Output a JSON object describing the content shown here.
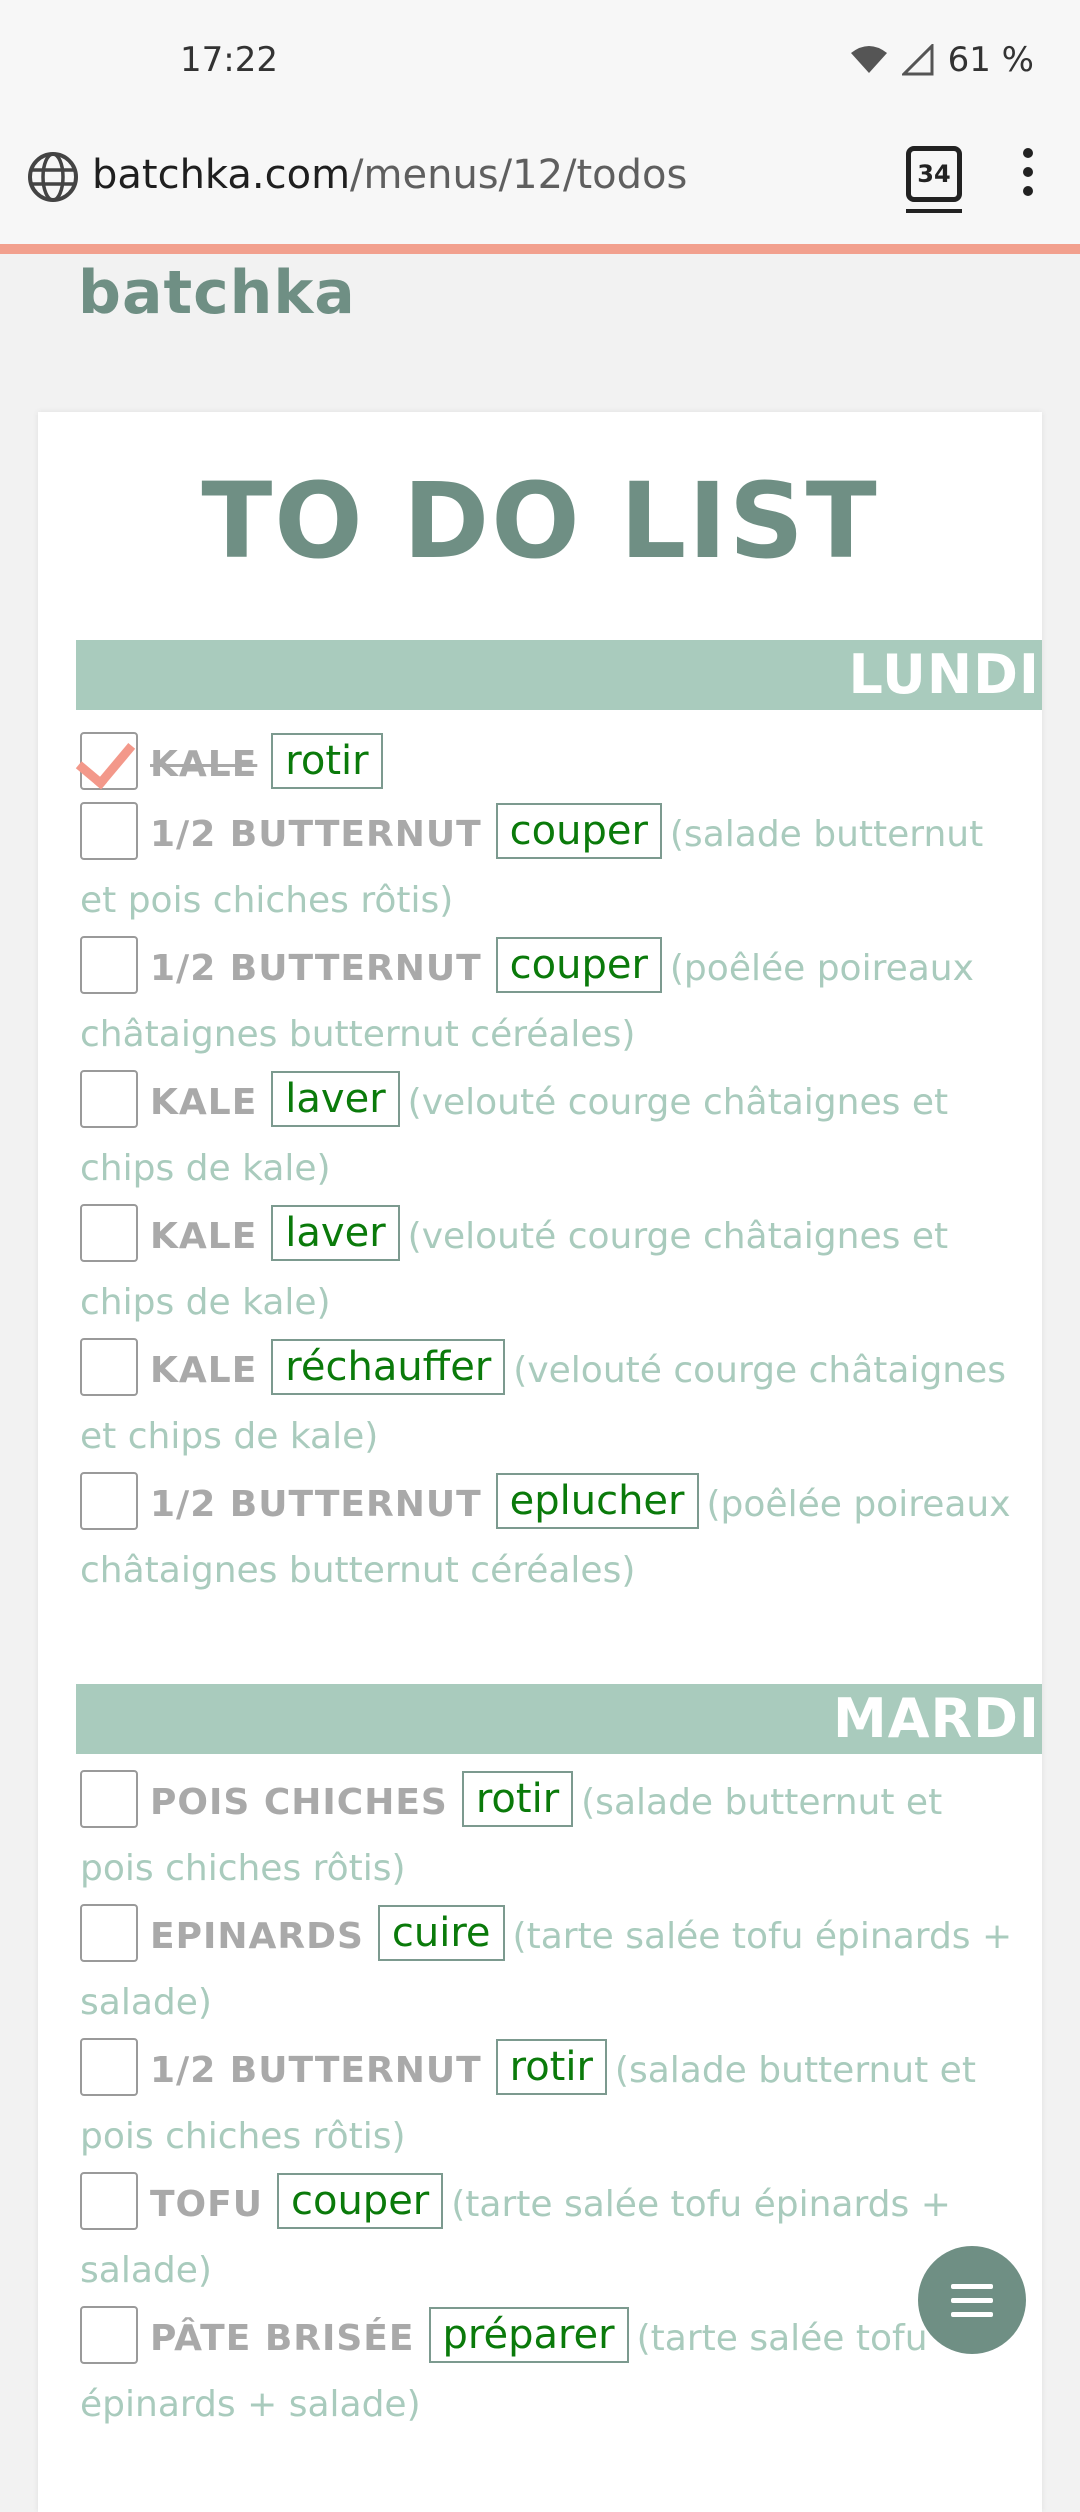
{
  "status_bar": {
    "time": "17:22",
    "battery": "61 %"
  },
  "browser": {
    "url_domain": "batchka.com",
    "url_path": "/menus/12/todos",
    "tab_count": "34"
  },
  "site": {
    "brand": "batchka",
    "title": "TO DO LIST"
  },
  "days": [
    {
      "label": "LUNDI",
      "items": [
        {
          "checked": true,
          "ingredient": "KALE",
          "action": "rotir",
          "note": ""
        },
        {
          "checked": false,
          "ingredient": "1/2 BUTTERNUT",
          "action": "couper",
          "note": "(salade butternut et pois chiches rôtis)"
        },
        {
          "checked": false,
          "ingredient": "1/2 BUTTERNUT",
          "action": "couper",
          "note": "(poêlée poireaux châtaignes butternut céréales)"
        },
        {
          "checked": false,
          "ingredient": "KALE",
          "action": "laver",
          "note": "(velouté courge châtaignes et chips de kale)"
        },
        {
          "checked": false,
          "ingredient": "KALE",
          "action": "laver",
          "note": "(velouté courge châtaignes et chips de kale)"
        },
        {
          "checked": false,
          "ingredient": "KALE",
          "action": "réchauffer",
          "note": "(velouté courge châtaignes et chips de kale)"
        },
        {
          "checked": false,
          "ingredient": "1/2 BUTTERNUT",
          "action": "eplucher",
          "note": "(poêlée poireaux châtaignes butternut céréales)"
        }
      ]
    },
    {
      "label": "MARDI",
      "items": [
        {
          "checked": false,
          "ingredient": "POIS CHICHES",
          "action": "rotir",
          "note": "(salade butternut et pois chiches rôtis)"
        },
        {
          "checked": false,
          "ingredient": "EPINARDS",
          "action": "cuire",
          "note": "(tarte salée tofu épinards + salade)"
        },
        {
          "checked": false,
          "ingredient": "1/2 BUTTERNUT",
          "action": "rotir",
          "note": "(salade butternut et pois chiches rôtis)"
        },
        {
          "checked": false,
          "ingredient": "TOFU",
          "action": "couper",
          "note": "(tarte salée tofu épinards + salade)"
        },
        {
          "checked": false,
          "ingredient": "PÂTE BRISÉE",
          "action": "préparer",
          "note": "(tarte salée tofu épinards + salade)"
        }
      ]
    }
  ],
  "icons": {
    "url_bar": "globe-icon",
    "menu": "three-dots-icon",
    "fab": "hamburger-menu-icon",
    "status": [
      "wifi-icon",
      "signal-icon"
    ]
  },
  "colors": {
    "accent": "#6f8f84",
    "day_bar": "#a9cbbd",
    "action_text": "#0a7a0a",
    "check": "#f3988a",
    "progress": "#f2a08e"
  }
}
